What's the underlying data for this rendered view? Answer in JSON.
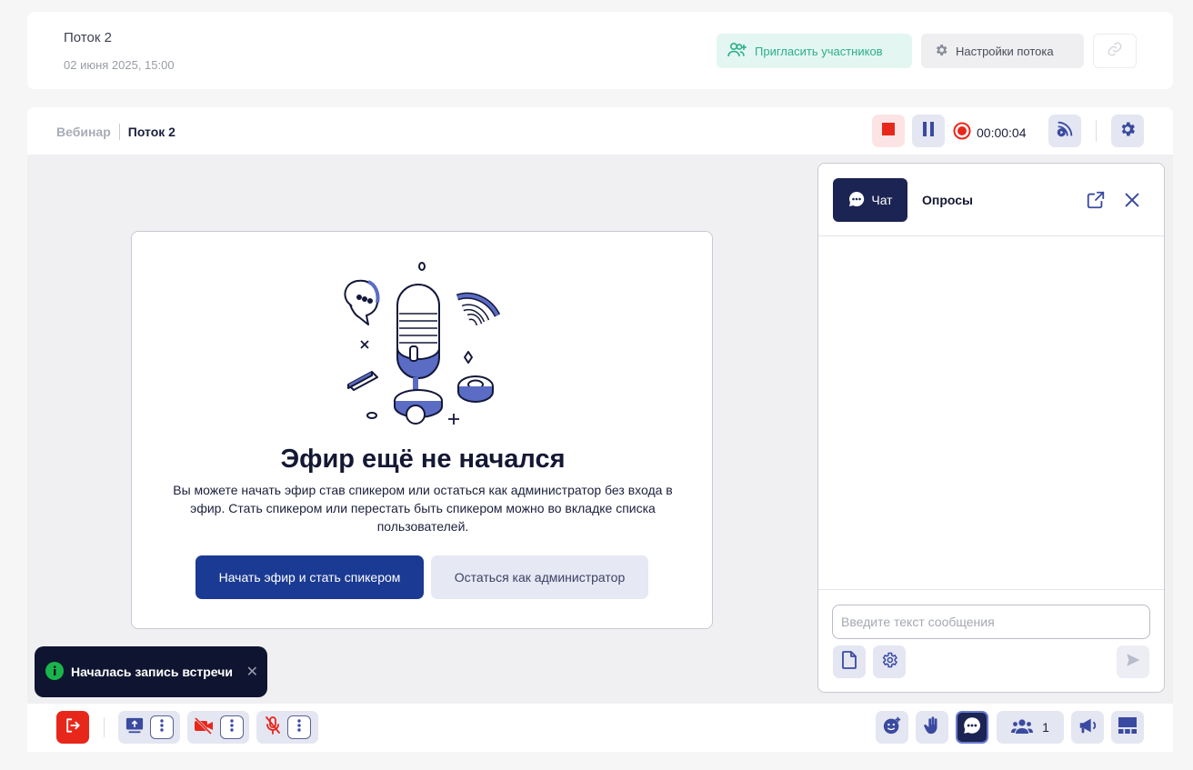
{
  "header": {
    "title": "Поток 2",
    "date": "02 июня 2025, 15:00",
    "invite_label": "Пригласить участников",
    "settings_label": "Настройки потока"
  },
  "breadcrumb": {
    "webinar": "Вебинар",
    "stream": "Поток 2"
  },
  "recording": {
    "time": "00:00:04"
  },
  "empty_state": {
    "title": "Эфир ещё не начался",
    "description": "Вы можете начать эфир став спикером или остаться как администратор без входа в эфир. Стать спикером или перестать быть спикером можно во вкладке списка пользователей.",
    "primary_button": "Начать эфир и стать спикером",
    "secondary_button": "Остаться как администратор"
  },
  "chat_panel": {
    "tab_chat": "Чат",
    "tab_polls": "Опросы",
    "input_placeholder": "Введите текст сообщения"
  },
  "toast": {
    "text": "Началась запись встречи"
  },
  "bottom_bar": {
    "participants_count": "1"
  },
  "colors": {
    "accent": "#1b3a93",
    "danger": "#e8271b",
    "invite_green": "#2bb08a",
    "dark_navy": "#1b2452"
  }
}
